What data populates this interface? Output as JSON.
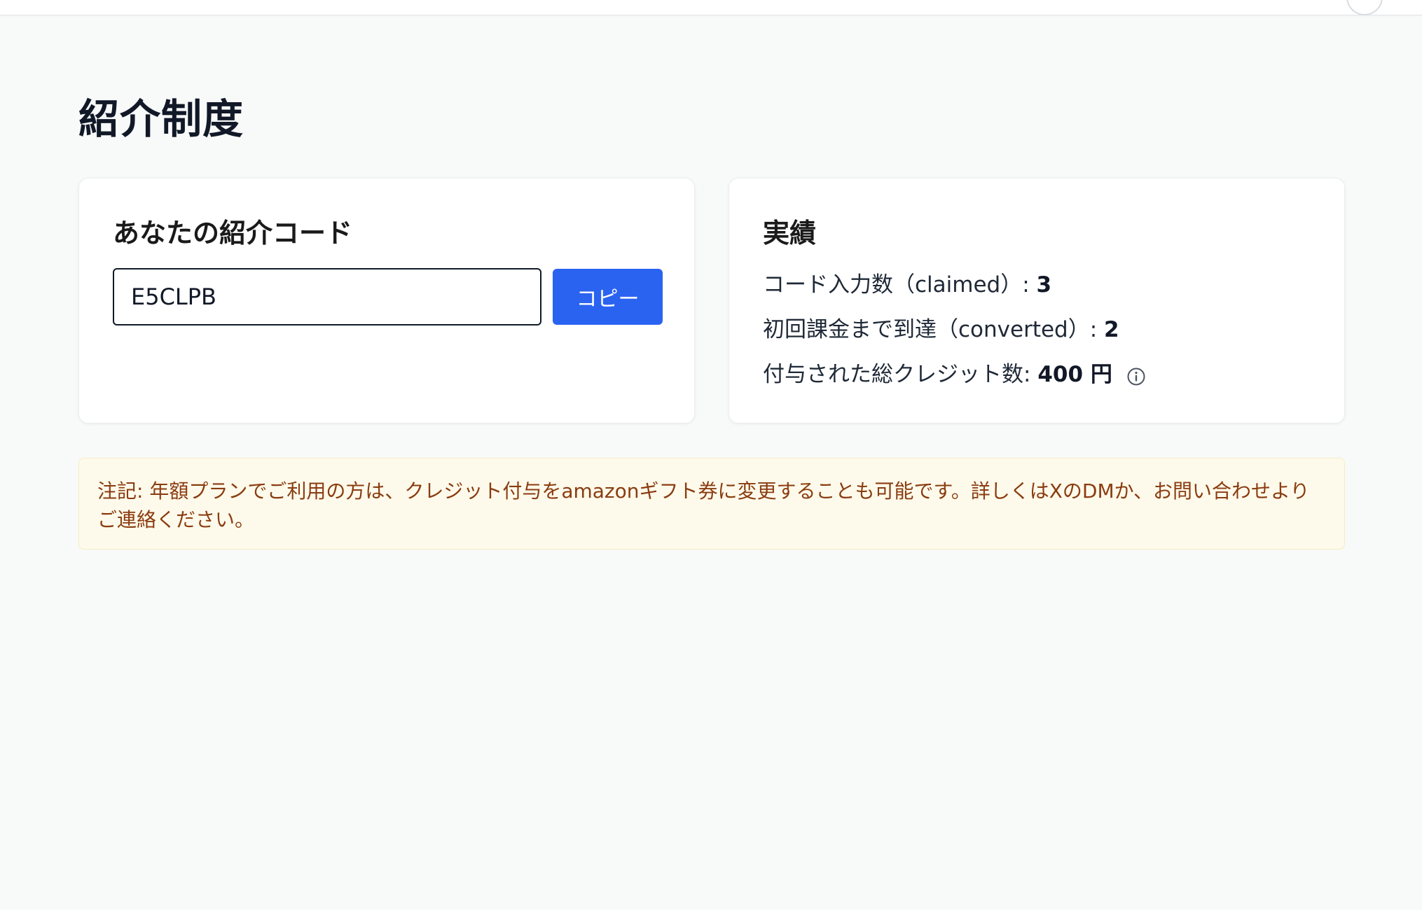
{
  "page": {
    "title": "紹介制度"
  },
  "referral_card": {
    "title": "あなたの紹介コード",
    "code_value": "E5CLPB",
    "copy_label": "コピー"
  },
  "stats_card": {
    "title": "実績",
    "claimed_label": "コード入力数（claimed）: ",
    "claimed_value": "3",
    "converted_label": "初回課金まで到達（converted）: ",
    "converted_value": "2",
    "credits_label": "付与された総クレジット数: ",
    "credits_value": "400 円",
    "info_icon": "info-circle-icon"
  },
  "notice": {
    "text": "注記: 年額プランでご利用の方は、クレジット付与をamazonギフト券に変更することも可能です。詳しくはXのDMか、お問い合わせよりご連絡ください。"
  },
  "colors": {
    "background": "#f8f9f9",
    "accent": "#2b63f1",
    "notice_bg": "#fefaeb",
    "notice_text": "#8a3c10"
  }
}
